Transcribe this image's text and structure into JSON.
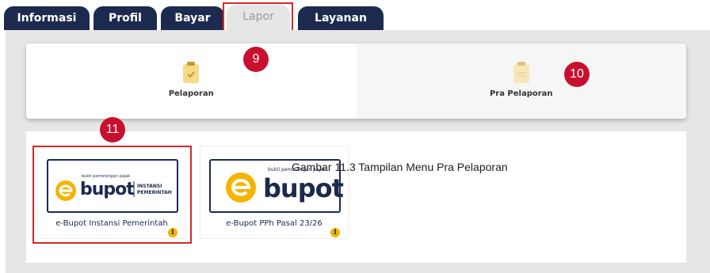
{
  "tabs": [
    {
      "label": "Informasi"
    },
    {
      "label": "Profil"
    },
    {
      "label": "Bayar"
    },
    {
      "label": "Lapor",
      "active": true
    },
    {
      "label": "Layanan"
    }
  ],
  "menu": {
    "pelaporan": {
      "label": "Pelaporan",
      "icon": "clipboard-check-icon"
    },
    "pra_pelaporan": {
      "label": "Pra Pelaporan",
      "icon": "clipboard-icon"
    }
  },
  "apps": [
    {
      "label": "e-Bupot Instansi Pemerintah",
      "logo_tagline": "bukti pemotongan pajak",
      "logo_word": "bupot",
      "logo_sub_line1": "INSTANSI",
      "logo_sub_line2": "PEMERINTAH"
    },
    {
      "label": "e-Bupot PPh Pasal 23/26",
      "logo_tagline": "bukti pemotongan pajak",
      "logo_word": "bupot"
    }
  ],
  "info_glyph": "i",
  "markers": [
    "9",
    "10",
    "11"
  ],
  "caption": "Gambar 11.3 Tampilan Menu Pra Pelaporan",
  "colors": {
    "navy": "#1c2a4e",
    "tab_inactive": "#1c2a4e",
    "marker_red": "#c8102e",
    "highlight_red": "#d62828",
    "logo_yellow": "#f4b400",
    "info_yellow": "#f0b400"
  }
}
